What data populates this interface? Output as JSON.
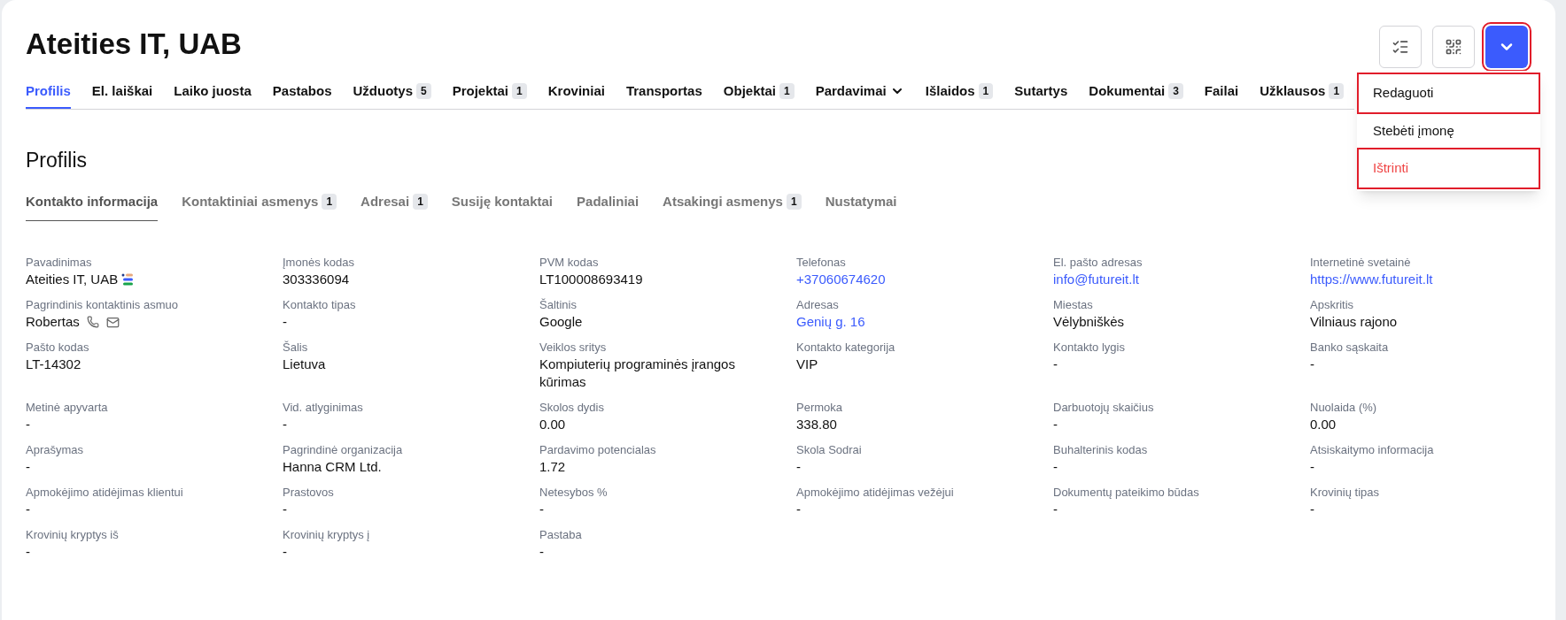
{
  "title": "Ateities IT, UAB",
  "tabs": [
    {
      "label": "Profilis",
      "selected": true,
      "dropdown": false
    },
    {
      "label": "El. laiškai",
      "selected": false,
      "dropdown": false
    },
    {
      "label": "Laiko juosta",
      "selected": false,
      "dropdown": false
    },
    {
      "label": "Pastabos",
      "selected": false,
      "dropdown": false
    },
    {
      "label": "Užduotys",
      "badge": "5",
      "selected": false,
      "dropdown": false
    },
    {
      "label": "Projektai",
      "badge": "1",
      "selected": false,
      "dropdown": false
    },
    {
      "label": "Kroviniai",
      "selected": false,
      "dropdown": false
    },
    {
      "label": "Transportas",
      "selected": false,
      "dropdown": false
    },
    {
      "label": "Objektai",
      "badge": "1",
      "selected": false,
      "dropdown": false
    },
    {
      "label": "Pardavimai",
      "selected": false,
      "dropdown": true
    },
    {
      "label": "Išlaidos",
      "badge": "1",
      "selected": false,
      "dropdown": false
    },
    {
      "label": "Sutartys",
      "selected": false,
      "dropdown": false
    },
    {
      "label": "Dokumentai",
      "badge": "3",
      "selected": false,
      "dropdown": false
    },
    {
      "label": "Failai",
      "selected": false,
      "dropdown": false
    },
    {
      "label": "Užklausos",
      "badge": "1",
      "selected": false,
      "dropdown": false
    }
  ],
  "toolbar": [
    {
      "kind": "checklist",
      "highlighted": false
    },
    {
      "kind": "qr",
      "highlighted": false
    },
    {
      "kind": "more",
      "highlighted": true
    }
  ],
  "menu": [
    {
      "label": "Redaguoti",
      "kind": "normal",
      "highlighted": true
    },
    {
      "label": "Stebėti įmonę",
      "kind": "normal",
      "highlighted": false
    },
    {
      "label": "Ištrinti",
      "kind": "danger",
      "highlighted": true
    }
  ],
  "section_title": "Profilis",
  "subtabs": [
    {
      "label": "Kontakto informacija",
      "selected": true
    },
    {
      "label": "Kontaktiniai asmenys",
      "badge": "1",
      "selected": false
    },
    {
      "label": "Adresai",
      "badge": "1",
      "selected": false
    },
    {
      "label": "Susiję kontaktai",
      "selected": false
    },
    {
      "label": "Padaliniai",
      "selected": false
    },
    {
      "label": "Atsakingi asmenys",
      "badge": "1",
      "selected": false
    },
    {
      "label": "Nustatymai",
      "selected": false
    }
  ],
  "fields": [
    {
      "label": "Pavadinimas",
      "value": "Ateities IT, UAB",
      "kind": "company"
    },
    {
      "label": "Įmonės kodas",
      "value": "303336094",
      "kind": "text"
    },
    {
      "label": "PVM kodas",
      "value": "LT100008693419",
      "kind": "text"
    },
    {
      "label": "Telefonas",
      "value": "+37060674620",
      "kind": "link"
    },
    {
      "label": "El. pašto adresas",
      "value": "info@futureit.lt",
      "kind": "link"
    },
    {
      "label": "Internetinė svetainė",
      "value": "https://www.futureit.lt",
      "kind": "link"
    },
    {
      "label": "Pagrindinis kontaktinis asmuo",
      "value": "Robertas",
      "kind": "person"
    },
    {
      "label": "Kontakto tipas",
      "value": "-",
      "kind": "text"
    },
    {
      "label": "Šaltinis",
      "value": "Google",
      "kind": "text"
    },
    {
      "label": "Adresas",
      "value": "Genių g. 16",
      "kind": "link"
    },
    {
      "label": "Miestas",
      "value": "Vėlybniškės",
      "kind": "text"
    },
    {
      "label": "Apskritis",
      "value": "Vilniaus rajono",
      "kind": "text"
    },
    {
      "label": "Pašto kodas",
      "value": "LT-14302",
      "kind": "text"
    },
    {
      "label": "Šalis",
      "value": "Lietuva",
      "kind": "text"
    },
    {
      "label": "Veiklos sritys",
      "value": "Kompiuterių programinės įrangos kūrimas",
      "kind": "text"
    },
    {
      "label": "Kontakto kategorija",
      "value": "VIP",
      "kind": "text"
    },
    {
      "label": "Kontakto lygis",
      "value": "-",
      "kind": "text"
    },
    {
      "label": "Banko sąskaita",
      "value": "-",
      "kind": "text"
    },
    {
      "label": "Metinė apyvarta",
      "value": "-",
      "kind": "text"
    },
    {
      "label": "Vid. atlyginimas",
      "value": "-",
      "kind": "text"
    },
    {
      "label": "Skolos dydis",
      "value": "0.00",
      "kind": "text"
    },
    {
      "label": "Permoka",
      "value": "338.80",
      "kind": "text"
    },
    {
      "label": "Darbuotojų skaičius",
      "value": "-",
      "kind": "text"
    },
    {
      "label": "Nuolaida (%)",
      "value": "0.00",
      "kind": "text"
    },
    {
      "label": "Aprašymas",
      "value": "-",
      "kind": "text"
    },
    {
      "label": "Pagrindinė organizacija",
      "value": "Hanna CRM Ltd.",
      "kind": "text"
    },
    {
      "label": "Pardavimo potencialas",
      "value": "1.72",
      "kind": "text"
    },
    {
      "label": "Skola Sodrai",
      "value": "-",
      "kind": "text"
    },
    {
      "label": "Buhalterinis kodas",
      "value": "-",
      "kind": "text"
    },
    {
      "label": "Atsiskaitymo informacija",
      "value": "-",
      "kind": "text"
    },
    {
      "label": "Apmokėjimo atidėjimas klientui",
      "value": "-",
      "kind": "text"
    },
    {
      "label": "Prastovos",
      "value": "-",
      "kind": "text"
    },
    {
      "label": "Netesybos %",
      "value": "-",
      "kind": "text"
    },
    {
      "label": "Apmokėjimo atidėjimas vežėjui",
      "value": "-",
      "kind": "text"
    },
    {
      "label": "Dokumentų pateikimo būdas",
      "value": "-",
      "kind": "text"
    },
    {
      "label": "Krovinių tipas",
      "value": "-",
      "kind": "text"
    },
    {
      "label": "Krovinių kryptys iš",
      "value": "-",
      "kind": "text"
    },
    {
      "label": "Krovinių kryptys į",
      "value": "-",
      "kind": "text"
    },
    {
      "label": "Pastaba",
      "value": "-",
      "kind": "text"
    }
  ]
}
